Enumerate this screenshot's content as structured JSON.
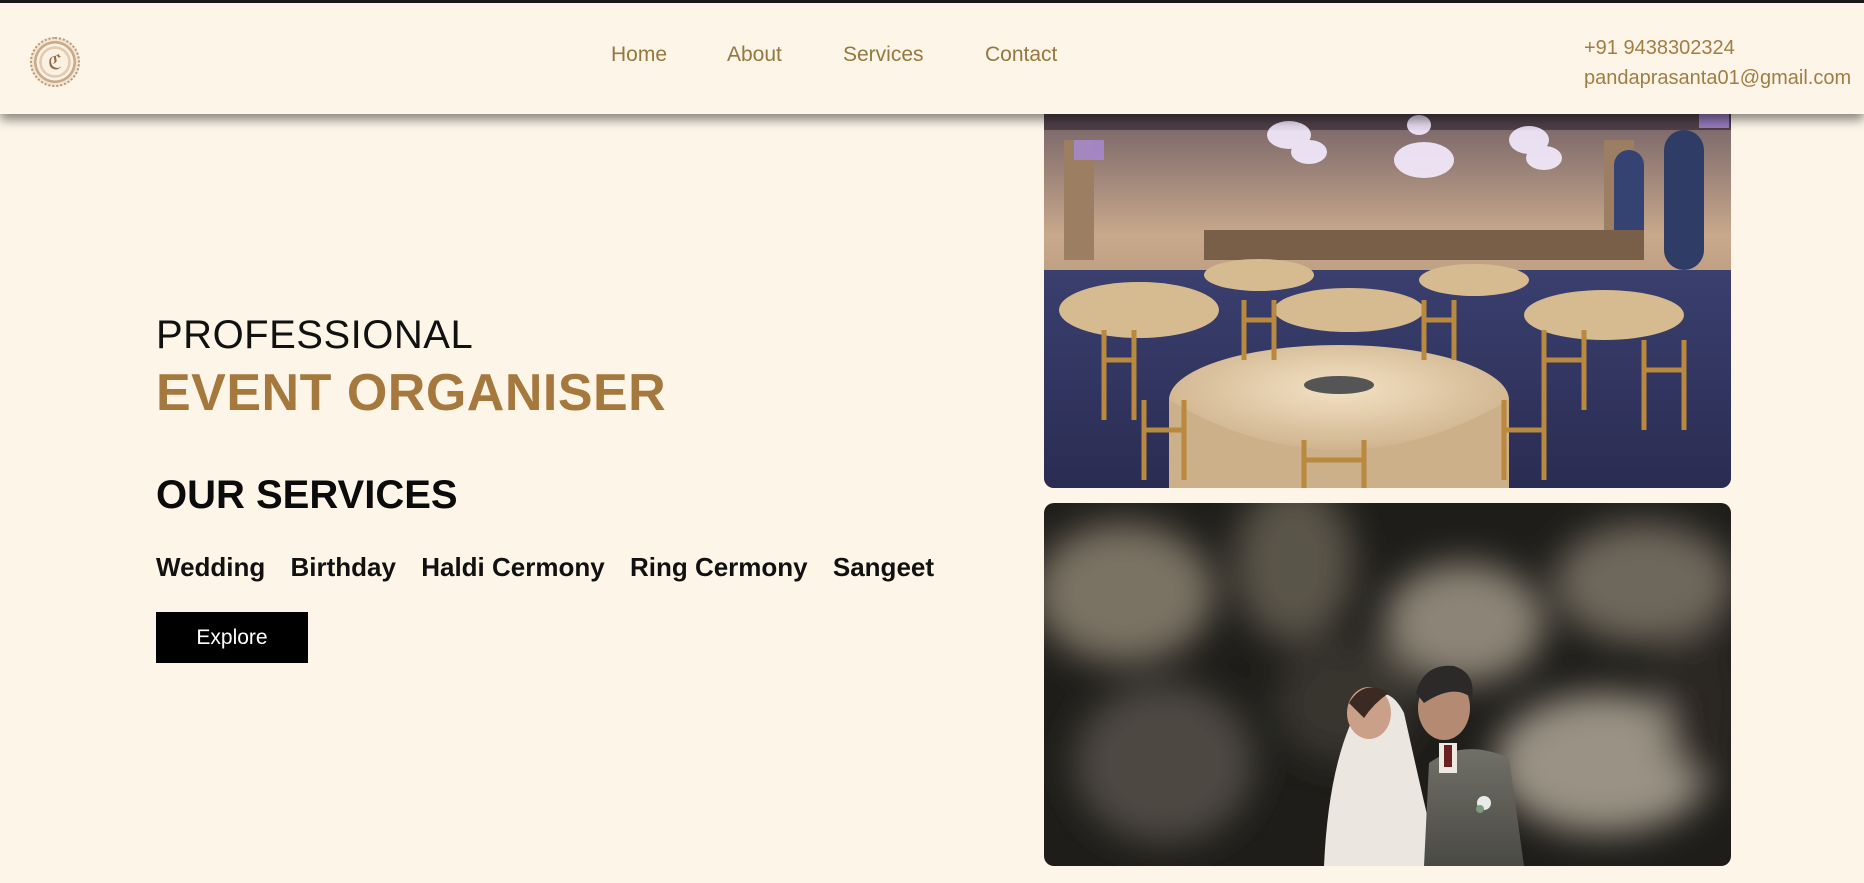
{
  "nav": {
    "logo_icon": "ornamental-logo-icon",
    "links": [
      "Home",
      "About",
      "Services",
      "Contact"
    ],
    "phone": "+91 9438302324",
    "email": "pandaprasanta01@gmail.com"
  },
  "hero": {
    "line1": "PROFESSIONAL",
    "line2": "EVENT ORGANISER",
    "services_title": "OUR SERVICES",
    "services": [
      "Wedding",
      "Birthday",
      "Haldi Cermony",
      "Ring Cermony",
      "Sangeet"
    ],
    "cta_label": "Explore"
  },
  "colors": {
    "background": "#fdf5e8",
    "accent": "#a5783d",
    "nav_text": "#96773f",
    "button": "#000000"
  },
  "images": {
    "photo1": "banquet-hall-photo",
    "photo2": "wedding-couple-photo"
  }
}
